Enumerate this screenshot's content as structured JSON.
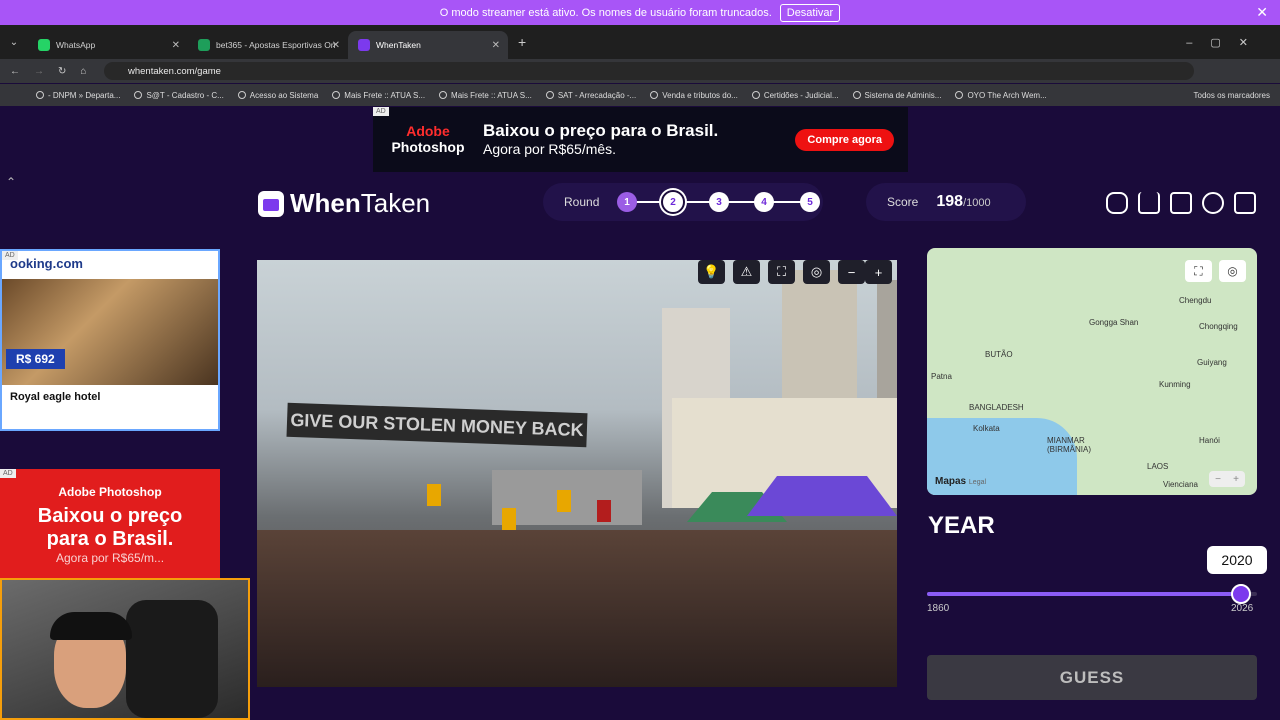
{
  "streamer": {
    "message": "O modo streamer está ativo. Os nomes de usuário foram truncados.",
    "button": "Desativar",
    "close": "✕"
  },
  "tabs": [
    {
      "label": "WhatsApp",
      "color": "#25d366"
    },
    {
      "label": "bet365 - Apostas Esportivas On",
      "color": "#1e9e5a"
    },
    {
      "label": "WhenTaken",
      "color": "#7c3aed"
    }
  ],
  "address": {
    "url": "whentaken.com/game"
  },
  "bookmarks": [
    "- DNPM » Departa...",
    "S@T - Cadastro - C...",
    "Acesso ao Sistema",
    "Mais Frete :: ATUA S...",
    "Mais Frete :: ATUA S...",
    "SAT - Arrecadação -...",
    "Venda e tributos do...",
    "Certidões - Judicial...",
    "Sistema de Adminis...",
    "OYO The Arch Wem...",
    "Todos os marcadores"
  ],
  "ad_top": {
    "badge": "AD",
    "brand_top": "Adobe",
    "brand_bottom": "Photoshop",
    "headline": "Baixou o preço para o Brasil.",
    "sub": "Agora por R$65/mês.",
    "cta": "Compre agora"
  },
  "brand": {
    "when": "When",
    "taken": "Taken"
  },
  "round": {
    "label": "Round",
    "items": [
      "1",
      "2",
      "3",
      "4",
      "5"
    ]
  },
  "score": {
    "label": "Score",
    "value": "198",
    "max": "/1000"
  },
  "ad_left": {
    "badge": "AD",
    "brand": "ooking.com",
    "price": "R$ 692",
    "hotel": "Royal eagle hotel"
  },
  "ad_left2": {
    "badge": "AD",
    "brand": "Adobe Photoshop",
    "msg1": "Baixou o preço",
    "msg2": "para o Brasil.",
    "sub": "Agora por R$65/m..."
  },
  "photo": {
    "banner": "GIVE OUR STOLEN MONEY BACK"
  },
  "map": {
    "labels": [
      "Chengdu",
      "Gongga Shan",
      "Chongqing",
      "BUTÃO",
      "Guiyang",
      "Patna",
      "Kunming",
      "BANGLADESH",
      "Kolkata",
      "MIANMAR (BIRMÂNIA)",
      "Hanói",
      "LAOS",
      "Vienciana"
    ],
    "attribution": "Mapas",
    "legal": "Legal"
  },
  "year": {
    "title": "YEAR",
    "value": "2020",
    "min": "1860",
    "max": "2026",
    "fraction": 0.9518
  },
  "guess_label": "GUESS"
}
